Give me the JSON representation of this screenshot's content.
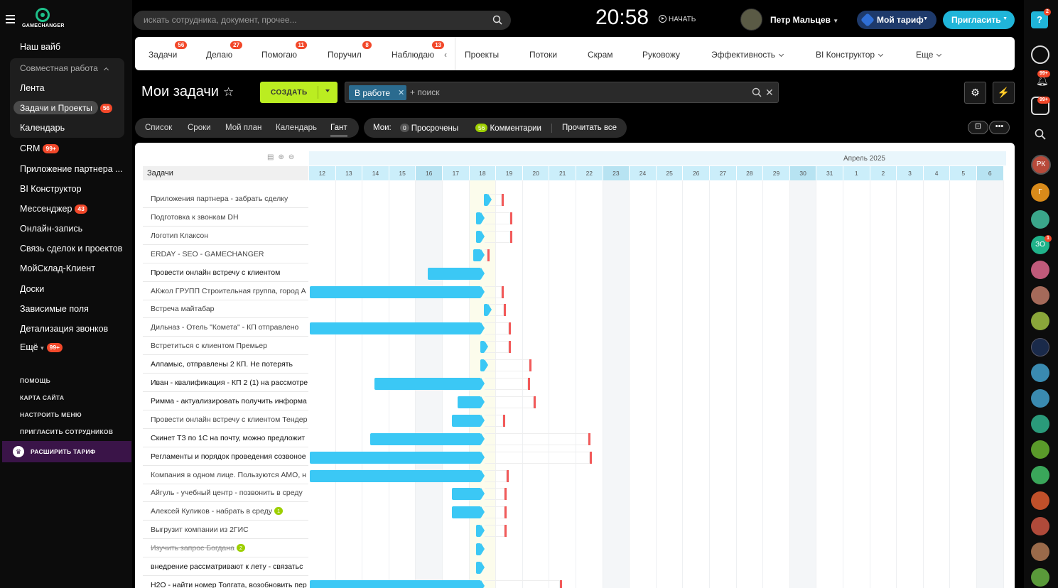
{
  "sidebar": {
    "logo_text": "GAMECHANGER",
    "our_vibe": "Наш вайб",
    "group_title": "Совместная работа",
    "group_items": [
      "Лента",
      "Задачи и Проекты",
      "Календарь"
    ],
    "active_badge": "56",
    "items": [
      {
        "label": "CRM",
        "badge": "99+"
      },
      {
        "label": "Приложение партнера ...",
        "badge": ""
      },
      {
        "label": "BI Конструктор",
        "badge": ""
      },
      {
        "label": "Мессенджер",
        "badge": "43"
      },
      {
        "label": "Онлайн-запись",
        "badge": ""
      },
      {
        "label": "Связь сделок и проектов",
        "badge": ""
      },
      {
        "label": "МойСклад-Клиент",
        "badge": ""
      },
      {
        "label": "Доски",
        "badge": ""
      },
      {
        "label": "Зависимые поля",
        "badge": ""
      },
      {
        "label": "Детализация звонков",
        "badge": ""
      },
      {
        "label": "Ещё",
        "badge": "99+"
      }
    ],
    "links": [
      "ПОМОЩЬ",
      "КАРТА САЙТА",
      "НАСТРОИТЬ МЕНЮ",
      "ПРИГЛАСИТЬ СОТРУДНИКОВ"
    ],
    "upgrade": "РАСШИРИТЬ ТАРИФ"
  },
  "topbar": {
    "search_placeholder": "искать сотрудника, документ, прочее...",
    "clock": "20:58",
    "start": "НАЧАТЬ",
    "user_name": "Петр Мальцев",
    "tariff": "Мой тариф",
    "invite": "Пригласить",
    "help_badge": "2"
  },
  "tabs": [
    {
      "label": "Задачи",
      "count": "56"
    },
    {
      "label": "Делаю",
      "count": "27"
    },
    {
      "label": "Помогаю",
      "count": "11"
    },
    {
      "label": "Поручил",
      "count": "8"
    },
    {
      "label": "Наблюдаю",
      "count": "13"
    }
  ],
  "tabs_right": [
    "Проекты",
    "Потоки",
    "Скрам",
    "Руковожу",
    "Эффективность",
    "BI Конструктор",
    "Еще"
  ],
  "page": {
    "title": "Мои задачи",
    "create": "СОЗДАТЬ",
    "filter_chip": "В работе",
    "filter_placeholder": "+ поиск"
  },
  "views": [
    "Список",
    "Сроки",
    "Мой план",
    "Календарь",
    "Гант"
  ],
  "counters": {
    "label": "Мои:",
    "overdue_count": "0",
    "overdue": "Просрочены",
    "comments_count": "56",
    "comments": "Комментарии",
    "read_all": "Прочитать все"
  },
  "gantt": {
    "column_header": "Задачи",
    "month": "Апрель 2025",
    "days": [
      "12",
      "13",
      "14",
      "15",
      "16",
      "17",
      "18",
      "19",
      "20",
      "21",
      "22",
      "23",
      "24",
      "25",
      "26",
      "27",
      "28",
      "29",
      "30",
      "31",
      "1",
      "2",
      "3",
      "4",
      "5",
      "6"
    ],
    "tasks": [
      {
        "label": "Приложения партнера - забрать сделку"
      },
      {
        "label": "Подготовка к звонкам DH"
      },
      {
        "label": "Логотип Клаксон"
      },
      {
        "label": "ERDAY - SEO - GAMECHANGER"
      },
      {
        "label": "Провести онлайн встречу с клиентом"
      },
      {
        "label": "АКжол ГРУПП Строительная группа, город А"
      },
      {
        "label": "Встреча майтабар"
      },
      {
        "label": "Дильназ - Отель \"Комета\" - КП отправлено"
      },
      {
        "label": "Встретиться с клиентом Премьер"
      },
      {
        "label": "Алпамыс, отправлены 2 КП. Не потерять"
      },
      {
        "label": "Иван - квалификация - КП 2 (1) на рассмотре"
      },
      {
        "label": "Римма - актуализировать получить информа"
      },
      {
        "label": "Провести онлайн встречу с клиентом Тендер"
      },
      {
        "label": "Скинет ТЗ по 1С на почту, можно предложит"
      },
      {
        "label": "Регламенты и порядок проведения созвоное"
      },
      {
        "label": "Компания в одном лице. Пользуются АМО, н"
      },
      {
        "label": "Айгуль - учебный центр - позвонить в среду"
      },
      {
        "label": "Алексей Куликов - набрать в среду",
        "badge": "1"
      },
      {
        "label": "Выгрузит компании из 2ГИС"
      },
      {
        "label": "Изучить запрос Богдана",
        "badge": "2"
      },
      {
        "label": "внедрение рассматривают к лету - связатьс"
      },
      {
        "label": "H2O - найти номер Толгата, возобновить пер"
      }
    ]
  },
  "right_strip": {
    "badges": [
      "99+",
      "99+",
      "1"
    ],
    "avatar_initials": [
      "РК",
      "Г",
      "ЗО"
    ]
  }
}
